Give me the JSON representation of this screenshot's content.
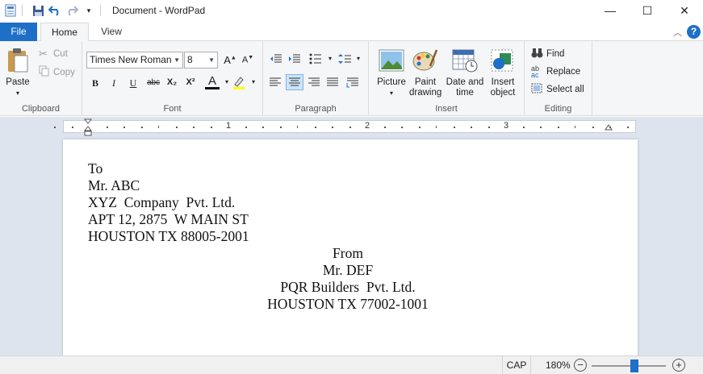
{
  "window": {
    "title": "Document - WordPad",
    "minimize_glyph": "—",
    "maximize_glyph": "☐",
    "close_glyph": "✕"
  },
  "tabs": {
    "file": "File",
    "home": "Home",
    "view": "View"
  },
  "ribbon": {
    "clipboard": {
      "label": "Clipboard",
      "paste": "Paste",
      "cut": "Cut",
      "copy": "Copy"
    },
    "font": {
      "label": "Font",
      "family": "Times New Roman",
      "size": "8",
      "bold": "B",
      "italic": "I",
      "underline": "U",
      "strike": "abc",
      "subscript": "X₂",
      "superscript": "X²",
      "grow": "A",
      "shrink": "A",
      "color": "A"
    },
    "paragraph": {
      "label": "Paragraph"
    },
    "insert": {
      "label": "Insert",
      "picture": [
        "Picture"
      ],
      "paint": [
        "Paint",
        "drawing"
      ],
      "datetime": [
        "Date and",
        "time"
      ],
      "object": [
        "Insert",
        "object"
      ]
    },
    "editing": {
      "label": "Editing",
      "find": "Find",
      "replace": "Replace",
      "select_all": "Select all"
    }
  },
  "ruler": {
    "numbers": [
      "1",
      "2",
      "3"
    ]
  },
  "document": {
    "left_lines": [
      "To",
      "Mr. ABC",
      "XYZ  Company  Pvt. Ltd.",
      "APT 12, 2875  W MAIN ST",
      "HOUSTON TX 88005-2001"
    ],
    "center_lines": [
      "From",
      "Mr. DEF",
      "PQR Builders  Pvt. Ltd.",
      "HOUSTON TX 77002-1001"
    ]
  },
  "status": {
    "cap": "CAP",
    "zoom": "180%",
    "zoom_fraction": 0.58,
    "zoom_out": "−",
    "zoom_in": "+"
  },
  "colors": {
    "accent": "#1e6fc8",
    "ribbon_bg": "#f5f6f7",
    "workspace_bg": "#dde4ee"
  }
}
